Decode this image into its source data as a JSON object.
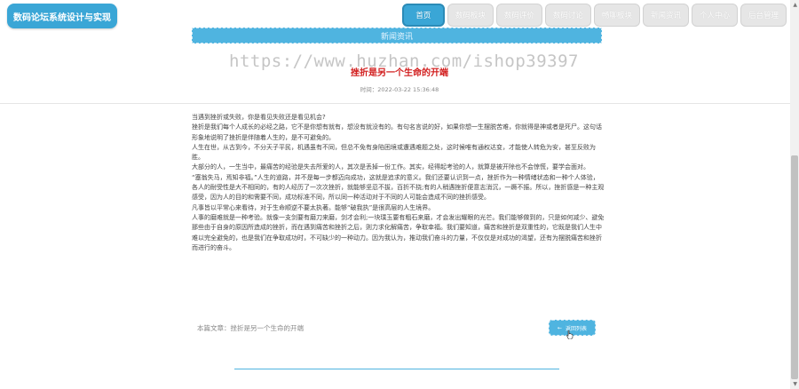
{
  "logo": {
    "title": "数码论坛系统设计与实现"
  },
  "nav": {
    "items": [
      {
        "label": "首页",
        "active": true
      },
      {
        "label": "数码板块",
        "active": false
      },
      {
        "label": "数码评价",
        "active": false
      },
      {
        "label": "数码讨论",
        "active": false
      },
      {
        "label": "畅聊板块",
        "active": false
      },
      {
        "label": "新闻资讯",
        "active": false
      },
      {
        "label": "个人中心",
        "active": false
      },
      {
        "label": "后台管理",
        "active": false
      }
    ]
  },
  "section": {
    "title": "新闻资讯"
  },
  "watermark": "https://www.huzhan.com/ishop39397",
  "article": {
    "title": "挫折是另一个生命的开端",
    "time": "时间：2022-03-22 15:36:48",
    "paragraphs": [
      "当遇到挫折或失败，你是看见失败还是看见机会?",
      "挫折是我们每个人成长的必经之路，它不是你想有就有，想没有就没有的。有句名言说的好，如果你想一生摆脱苦难，你就得是神或者是死尸。这句话形象地说明了挫折是伴随着人生的，是不可避免的。",
      "人生在世，从古到今，不分天子平民，机遇虽有不同，但总不免有身陷困境或遭遇难题之处，这时候唯有通权达变，才能使人转危为安，甚至反败为胜。",
      "大部分的人，一生当中，最痛苦的经验是失去所爱的人，其次是丢掉一份工作。其实，经得起考验的人，就算是被开除也不会惊慌，要学会面对。",
      "“塞翁失马，焉知非福。”人生的道路，并不是每一步都迈向成功，这就是追求的意义。我们还要认识到一点，挫折作为一种情绪状态和一种个人体验，各人的耐受性是大不相同的，有的人经历了一次次挫折，就能够坚忍不拔，百折不挠;有的人稍遇挫折便意志消沉，一蹶不振。所以，挫折感是一种主观感受，因为人的目的和需要不同，成功标准不同，所以同一种活动对于不同的人可能会造成不同的挫折感受。",
      "凡事皆以平常心来看待，对于生命顺逆不要太执著。能够“破我执”是很高层的人生境界。",
      "人事的磨难就是一种考验。就像一支剑要有磨刀来磨，剑才会利;一块璞玉要有粗石来磨，才会发出耀眼的光芒。我们能够做到的，只是如何减少、避免那些由于自身的原因所造成的挫折，而在遇到痛苦和挫折之后，则力求化解痛苦，争取幸福。我们要知道，痛苦和挫折是双重性的，它既是我们人生中难以完全避免的，也是我们在争取成功时，不可缺少的一种动力。因为我认为，推动我们奋斗的力量，不仅仅是对成功的渴望，还有为摆脱痛苦和挫折而进行的奋斗。"
    ],
    "prev_label": "本篇文章：挫折是另一个生命的开端",
    "back_button": "返回列表"
  }
}
